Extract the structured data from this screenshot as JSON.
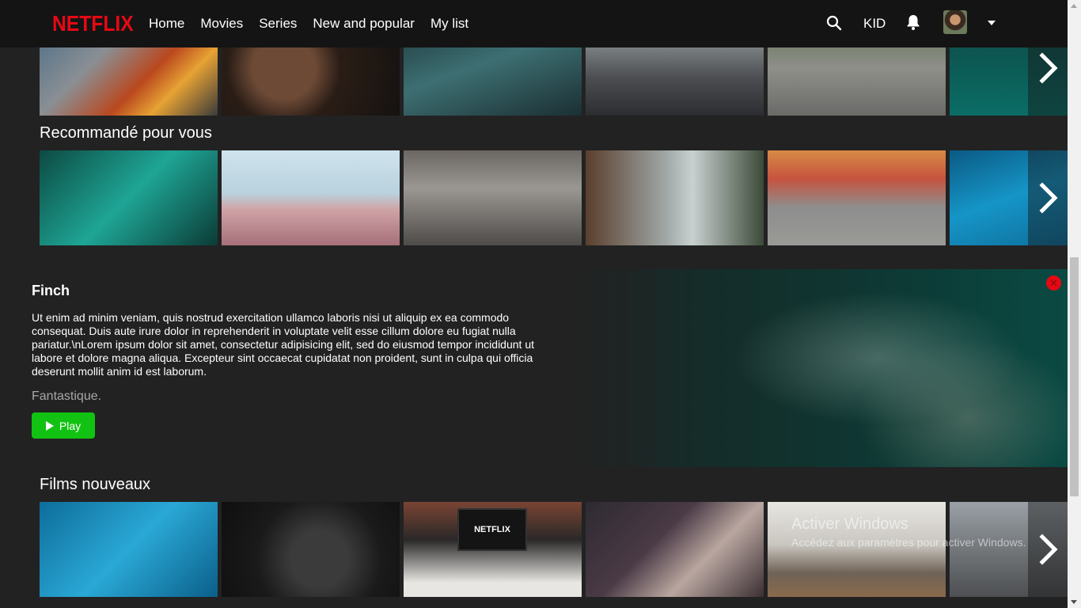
{
  "brand": {
    "logo": "NETFLIX",
    "accent": "#e50914"
  },
  "nav": {
    "items": [
      "Home",
      "Movies",
      "Series",
      "New and popular",
      "My list"
    ]
  },
  "header": {
    "profile_label": "KID"
  },
  "rows": [
    {
      "title": "",
      "tiles": 6
    },
    {
      "title": "Recommandé pour vous",
      "tiles": 6
    },
    {
      "title": "Films nouveaux",
      "tiles": 6
    }
  ],
  "detail": {
    "title": "Finch",
    "description": "Ut enim ad minim veniam, quis nostrud exercitation ullamco laboris nisi ut aliquip ex ea commodo consequat. Duis aute irure dolor in reprehenderit in voluptate velit esse cillum dolore eu fugiat nulla pariatur.\\nLorem ipsum dolor sit amet, consectetur adipisicing elit, sed do eiusmod tempor incididunt ut labore et dolore magna aliqua. Excepteur sint occaecat cupidatat non proident, sunt in culpa qui officia deserunt mollit anim id est laborum.",
    "tagline": "Fantastique.",
    "play_label": "Play",
    "play_color": "#12c212"
  },
  "tv_logo": "NETFLIX",
  "watermark": {
    "line1": "Activer Windows",
    "line2": "Accédez aux paramètres pour activer Windows."
  }
}
